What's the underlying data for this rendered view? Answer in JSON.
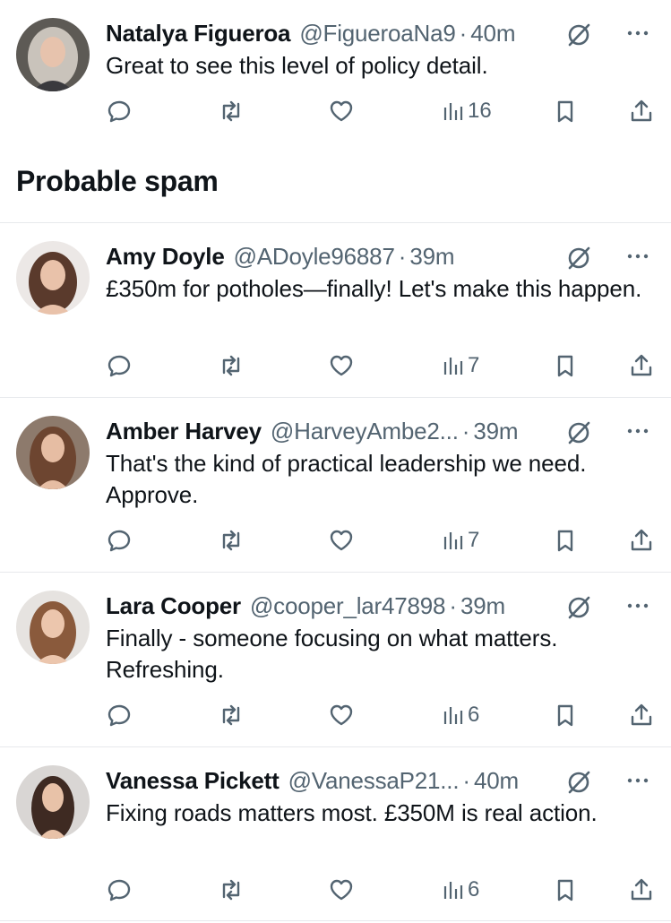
{
  "section": {
    "title": "Probable spam"
  },
  "tweets": [
    {
      "name": "Natalya Figueroa",
      "handle": "@FigueroaNa9",
      "time": "40m",
      "text": "Great to see this level of policy detail.",
      "views": "16",
      "avatar": {
        "bg": "#5d5a55",
        "hair": "#c9c3bb",
        "skin": "#e7c3ad"
      }
    },
    {
      "name": "Amy Doyle",
      "handle": "@ADoyle96887",
      "time": "39m",
      "text": "£350m for potholes—finally! Let's make this happen.",
      "views": "7",
      "avatar": {
        "bg": "#ece8e6",
        "hair": "#5a3a2c",
        "skin": "#e9c2aa"
      }
    },
    {
      "name": "Amber Harvey",
      "handle": "@HarveyAmbe2...",
      "time": "39m",
      "text": "That's the kind of practical leadership we need. Approve.",
      "views": "7",
      "avatar": {
        "bg": "#8d7a6c",
        "hair": "#6d4530",
        "skin": "#e6bda3"
      }
    },
    {
      "name": "Lara Cooper",
      "handle": "@cooper_lar47898",
      "time": "39m",
      "text": "Finally - someone focusing on what matters. Refreshing.",
      "views": "6",
      "avatar": {
        "bg": "#e6e3e0",
        "hair": "#8a5a3c",
        "skin": "#ecc6ad"
      }
    },
    {
      "name": "Vanessa Pickett",
      "handle": "@VanessaP21...",
      "time": "40m",
      "text": "Fixing roads matters most. £350M is real action.",
      "views": "6",
      "avatar": {
        "bg": "#d9d6d4",
        "hair": "#3e2a22",
        "skin": "#e8c2a8"
      }
    }
  ],
  "colors": {
    "text": "#0f1419",
    "secondary": "#536471",
    "divider": "#e7e9ec"
  }
}
